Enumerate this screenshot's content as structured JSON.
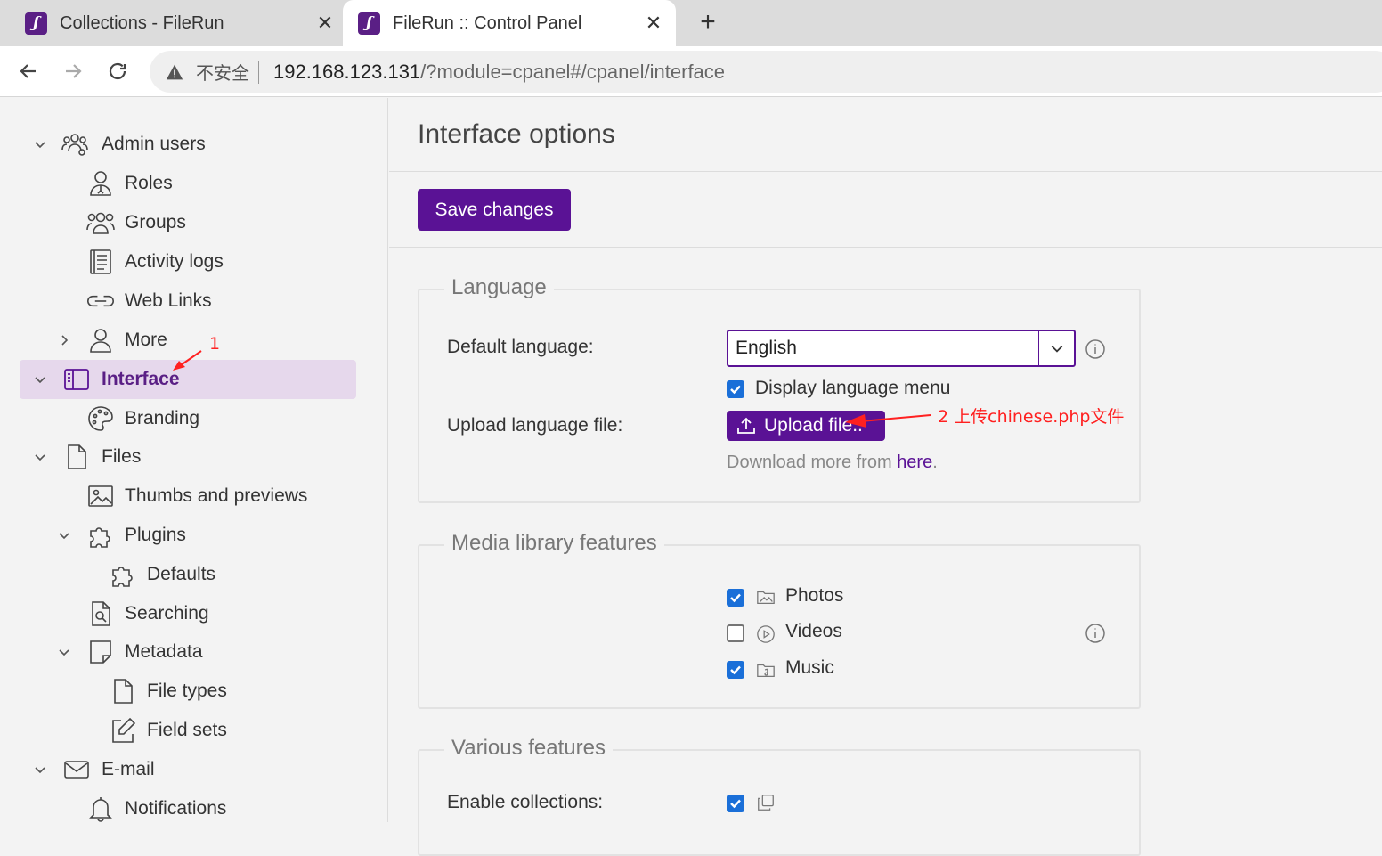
{
  "browser": {
    "tabs": [
      {
        "title": "Collections - FileRun",
        "favicon": "filerun-logo-icon"
      },
      {
        "title": "FileRun :: Control Panel",
        "favicon": "filerun-logo-icon"
      }
    ],
    "new_tab": "+",
    "address": {
      "security": "不安全",
      "host": "192.168.123.131",
      "path": "/?module=cpanel#/cpanel/interface"
    }
  },
  "sidebar": {
    "items": [
      {
        "label": "Admin users",
        "icon": "admin-users-icon",
        "expanded": true
      },
      {
        "label": "Roles",
        "icon": "roles-icon"
      },
      {
        "label": "Groups",
        "icon": "groups-icon"
      },
      {
        "label": "Activity logs",
        "icon": "activity-logs-icon"
      },
      {
        "label": "Web Links",
        "icon": "link-icon"
      },
      {
        "label": "More",
        "icon": "user-icon",
        "expanded": false
      },
      {
        "label": "Interface",
        "icon": "interface-icon",
        "expanded": true,
        "active": true
      },
      {
        "label": "Branding",
        "icon": "palette-icon"
      },
      {
        "label": "Files",
        "icon": "file-icon",
        "expanded": true
      },
      {
        "label": "Thumbs and previews",
        "icon": "image-icon"
      },
      {
        "label": "Plugins",
        "icon": "puzzle-icon",
        "expanded": true
      },
      {
        "label": "Defaults",
        "icon": "puzzle-icon"
      },
      {
        "label": "Searching",
        "icon": "search-file-icon"
      },
      {
        "label": "Metadata",
        "icon": "metadata-icon",
        "expanded": true
      },
      {
        "label": "File types",
        "icon": "file-icon"
      },
      {
        "label": "Field sets",
        "icon": "edit-icon"
      },
      {
        "label": "E-mail",
        "icon": "mail-icon",
        "expanded": true
      },
      {
        "label": "Notifications",
        "icon": "bell-icon"
      }
    ]
  },
  "main": {
    "title": "Interface options",
    "save_label": "Save changes",
    "language": {
      "legend": "Language",
      "default_language_label": "Default language:",
      "default_language_value": "English",
      "display_menu_label": "Display language menu",
      "display_menu_checked": true,
      "upload_label": "Upload language file:",
      "upload_button": "Upload file..",
      "download_prefix": "Download more from ",
      "download_link": "here",
      "download_suffix": "."
    },
    "media": {
      "legend": "Media library features",
      "items": [
        {
          "label": "Photos",
          "checked": true,
          "icon": "photos-folder-icon"
        },
        {
          "label": "Videos",
          "checked": false,
          "icon": "play-circle-icon"
        },
        {
          "label": "Music",
          "checked": true,
          "icon": "music-folder-icon"
        }
      ]
    },
    "various": {
      "legend": "Various features",
      "collections_label": "Enable collections:",
      "collections_checked": true
    }
  },
  "annotations": {
    "step1": "1",
    "step2": "2 上传chinese.php文件"
  },
  "colors": {
    "brand": "#5a1295",
    "active_bg": "#e6d8ec",
    "checkbox": "#1a6fd8",
    "annotation": "#ff2020"
  }
}
